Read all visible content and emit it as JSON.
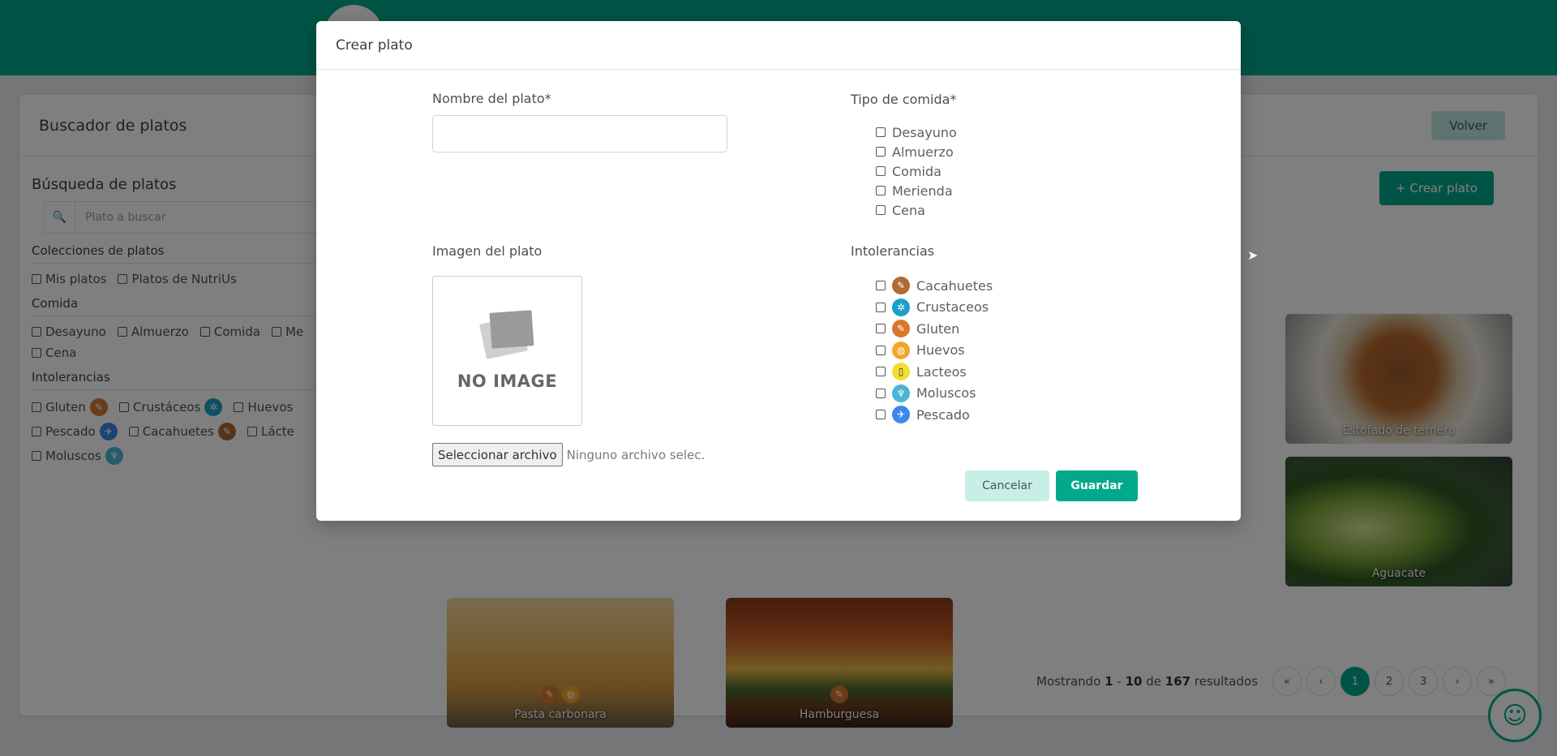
{
  "page": {
    "title": "Buscador de platos",
    "volver_label": "Volver",
    "crear_label": "+ Crear plato",
    "search_placeholder": "Plato a buscar"
  },
  "filters": {
    "heading": "Búsqueda de platos",
    "collections": {
      "title": "Colecciones de platos",
      "items": [
        "Mis platos",
        "Platos de NutriUs"
      ]
    },
    "meals": {
      "title": "Comida",
      "items": [
        "Desayuno",
        "Almuerzo",
        "Comida",
        "Me",
        "Cena"
      ]
    },
    "intolerances": {
      "title": "Intolerancias",
      "items": [
        {
          "label": "Gluten",
          "icon": "wheat-icon"
        },
        {
          "label": "Crustáceos",
          "icon": "shrimp-icon"
        },
        {
          "label": "Huevos",
          "icon": "egg-icon"
        },
        {
          "label": "Pescado",
          "icon": "fish-icon"
        },
        {
          "label": "Cacahuetes",
          "icon": "peanut-icon"
        },
        {
          "label": "Lácte",
          "icon": "milk-icon"
        },
        {
          "label": "Moluscos",
          "icon": "shell-icon"
        }
      ]
    }
  },
  "dishes": [
    {
      "name": "Estofado de ternera"
    },
    {
      "name": "Aguacate"
    },
    {
      "name": "Pasta carbonara"
    },
    {
      "name": "Hamburguesa"
    }
  ],
  "pagination": {
    "prefix": "Mostrando",
    "from": "1",
    "sep": "-",
    "to": "10",
    "of": "de",
    "total": "167",
    "suffix": "resultados",
    "pages": [
      "1",
      "2",
      "3"
    ],
    "active_page": "1"
  },
  "modal": {
    "title": "Crear plato",
    "name_label": "Nombre del plato*",
    "name_value": "",
    "meal_type_label": "Tipo de comida*",
    "meal_types": [
      "Desayuno",
      "Almuerzo",
      "Comida",
      "Merienda",
      "Cena"
    ],
    "image_label": "Imagen del plato",
    "no_image_text": "NO IMAGE",
    "file_button": "Seleccionar archivo",
    "file_status": "Ninguno archivo selec.",
    "intolerances_label": "Intolerancias",
    "intolerances": [
      {
        "label": "Cacahuetes",
        "icon": "peanut-icon"
      },
      {
        "label": "Crustaceos",
        "icon": "shrimp-icon"
      },
      {
        "label": "Gluten",
        "icon": "wheat-icon"
      },
      {
        "label": "Huevos",
        "icon": "egg-icon"
      },
      {
        "label": "Lacteos",
        "icon": "milk-icon"
      },
      {
        "label": "Moluscos",
        "icon": "shell-icon"
      },
      {
        "label": "Pescado",
        "icon": "fish-icon"
      }
    ],
    "cancel_label": "Cancelar",
    "save_label": "Guardar"
  },
  "colors": {
    "brand": "#00a98a",
    "brand_light": "#c8efe7"
  }
}
